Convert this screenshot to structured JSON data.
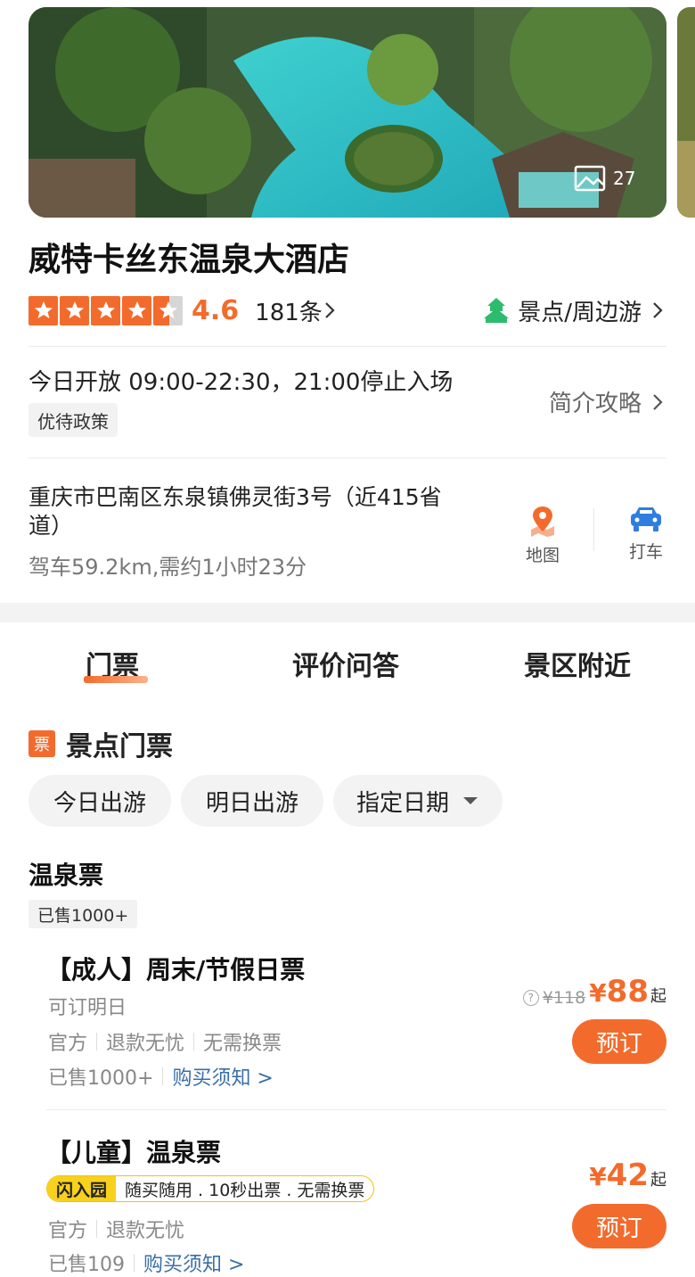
{
  "gallery": {
    "photo_count": "27",
    "icon": "image-icon"
  },
  "attraction": {
    "name": "威特卡丝东温泉大酒店",
    "rating": 4.6,
    "score_text": "4.6",
    "review_count": "181条",
    "category": "景点/周边游",
    "hours": "今日开放 09:00-22:30，21:00停止入场",
    "policy_tag": "优待政策",
    "guide_link": "简介攻略",
    "address": "重庆市巴南区东泉镇佛灵街3号（近415省道）",
    "drive_info": "驾车59.2km,需约1小时23分",
    "actions": {
      "map": "地图",
      "taxi": "打车"
    }
  },
  "tabs": [
    "门票",
    "评价问答",
    "景区附近"
  ],
  "tickets_section": {
    "icon_text": "票",
    "title": "景点门票",
    "date_filters": [
      "今日出游",
      "明日出游",
      "指定日期"
    ]
  },
  "ticket_group": {
    "title": "温泉票",
    "badge": "已售1000+",
    "items": [
      {
        "name": "【成人】周末/节假日票",
        "note": "可订明日",
        "features": [
          "官方",
          "退款无忧",
          "无需换票"
        ],
        "sold": "已售1000+",
        "notice": "购买须知 >",
        "original_price": "¥118",
        "price_symbol": "¥",
        "price": "88",
        "suffix": "起",
        "book_label": "预订"
      },
      {
        "name": "【儿童】温泉票",
        "flash_tag": "闪入园",
        "flash_text": "随买随用 . 10秒出票 . 无需换票",
        "features": [
          "官方",
          "退款无忧"
        ],
        "sold": "已售109",
        "notice": "购买须知 >",
        "price_symbol": "¥",
        "price": "42",
        "suffix": "起",
        "book_label": "预订"
      }
    ]
  },
  "colors": {
    "accent": "#f36b2c",
    "category_green": "#2dbb6e",
    "taxi_blue": "#2f7de1",
    "link_blue": "#3a6ea5"
  }
}
